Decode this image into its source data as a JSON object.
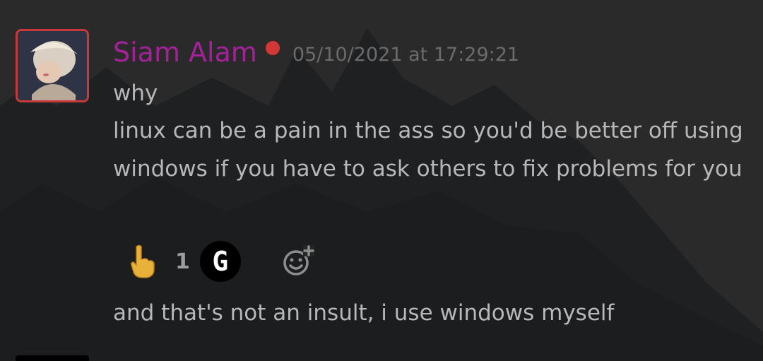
{
  "message": {
    "author": "Siam Alam",
    "timestamp": "05/10/2021 at 17:29:21",
    "status_color": "#d33636",
    "username_color": "#a5219a",
    "lines": [
      "why",
      "linux can be a pain in the ass so you'd be better off using windows if you have to ask others to fix problems for you"
    ],
    "reactions": [
      {
        "emoji": "pointing-up-hand-icon",
        "count": "1",
        "reactor_initial": "G"
      }
    ],
    "add_reaction_icon": "add-reaction-icon",
    "followup": "and that's not an insult, i use windows myself"
  }
}
